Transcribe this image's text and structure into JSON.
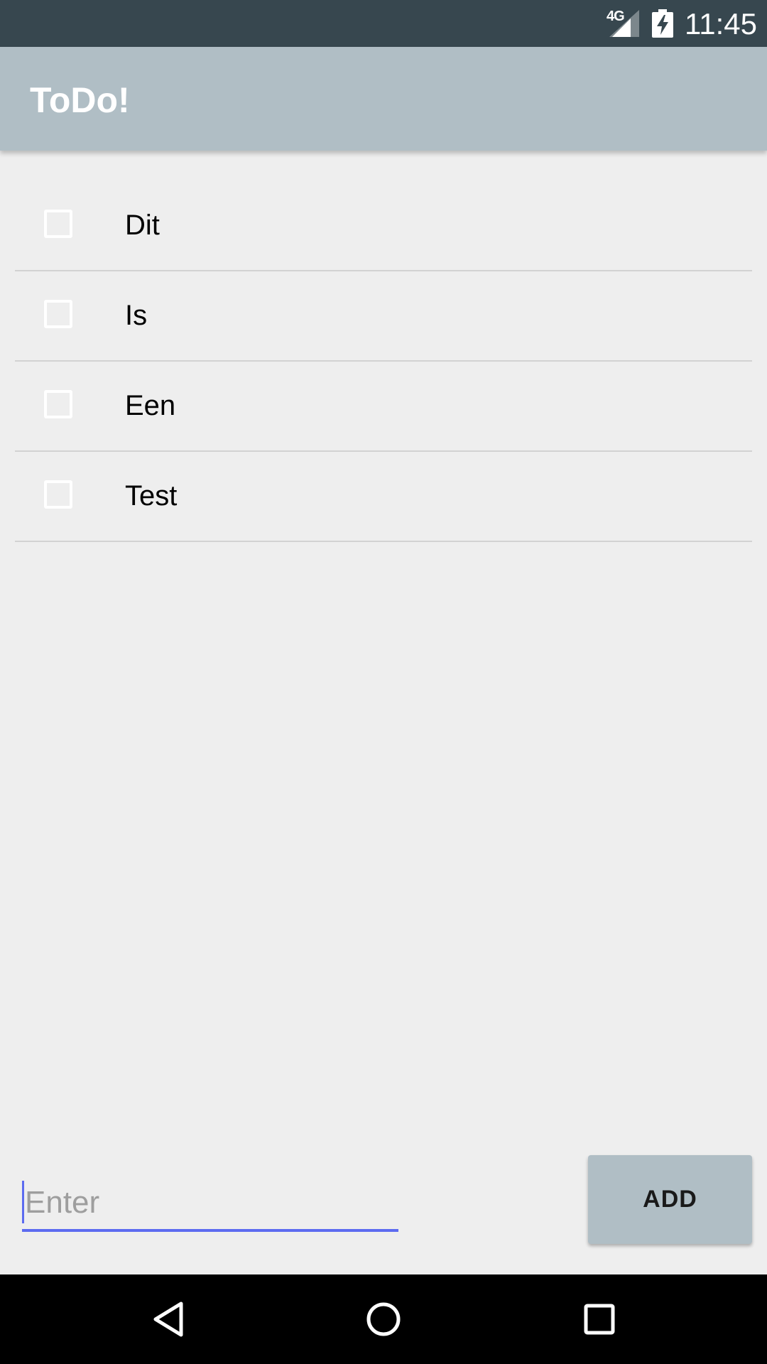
{
  "status_bar": {
    "network": "4G",
    "time": "11:45",
    "icons": [
      "signal-icon",
      "battery-charging-icon"
    ]
  },
  "app_bar": {
    "title": "ToDo!",
    "color": "#b0bec5"
  },
  "todos": [
    {
      "label": "Dit",
      "checked": false
    },
    {
      "label": "Is",
      "checked": false
    },
    {
      "label": "Een",
      "checked": false
    },
    {
      "label": "Test",
      "checked": false
    }
  ],
  "input": {
    "placeholder": "Enter",
    "value": "",
    "accent": "#5c6bf0"
  },
  "add_button": {
    "label": "ADD"
  },
  "nav_bar": {
    "icons": [
      "back-icon",
      "home-icon",
      "recents-icon"
    ]
  }
}
